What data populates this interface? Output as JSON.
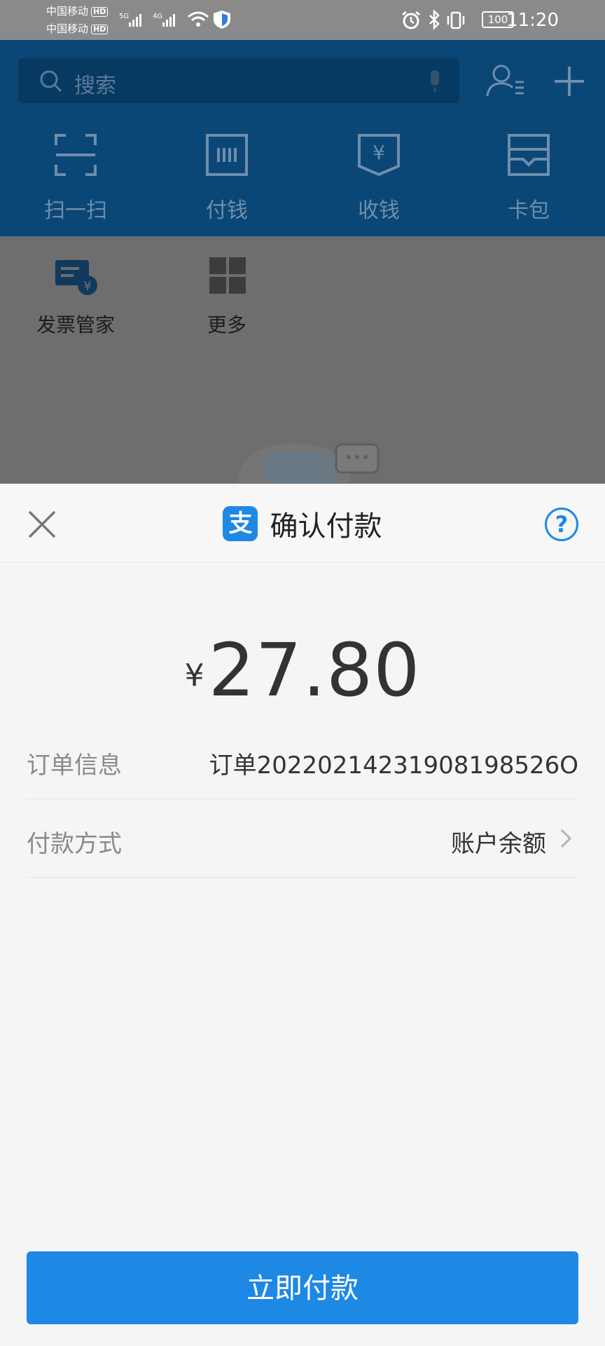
{
  "status_bar": {
    "carrier1": "中国移动",
    "carrier2": "中国移动",
    "hd": "HD",
    "net1": "5G",
    "net2": "4G",
    "battery": "100",
    "time": "11:20"
  },
  "background_app": {
    "search_placeholder": "搜索",
    "quick_actions": [
      "扫一扫",
      "付钱",
      "收钱",
      "卡包"
    ],
    "services": [
      "发票管家",
      "更多"
    ]
  },
  "sheet": {
    "title": "确认付款",
    "logo_char": "支",
    "help_char": "?",
    "currency": "¥",
    "amount": "27.80",
    "order_label": "订单信息",
    "order_value": "订单20220214231908198526O",
    "pay_method_label": "付款方式",
    "pay_method_value": "账户余额",
    "pay_button": "立即付款"
  },
  "colors": {
    "accent": "#1e88e5",
    "overlay_header": "#0a4777",
    "overlay_body": "#6e6e6e",
    "status_bar": "#8a8a8a"
  }
}
